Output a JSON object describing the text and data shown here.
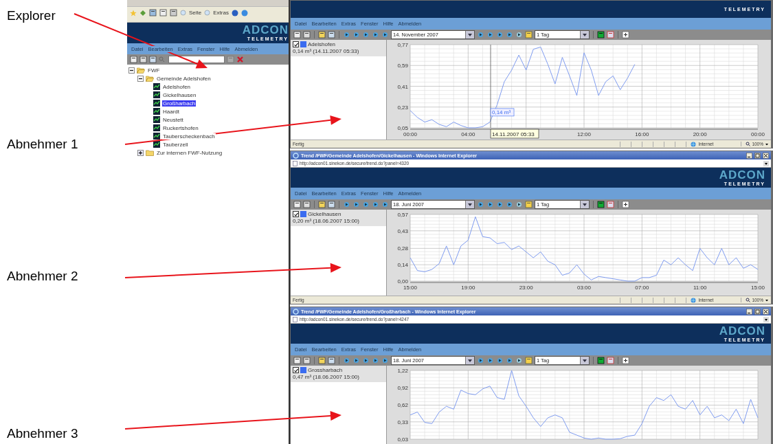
{
  "annotations": [
    {
      "text": "Explorer"
    },
    {
      "text": "Abnehmer 1"
    },
    {
      "text": "Abnehmer 2"
    },
    {
      "text": "Abnehmer 3"
    }
  ],
  "explorer": {
    "browser_toolbar": [
      "Seite",
      "Extras"
    ],
    "logo": {
      "brand": "ADCON",
      "tagline": "TELEMETRY"
    },
    "menu": [
      "Datei",
      "Bearbeiten",
      "Extras",
      "Fenster",
      "Hilfe",
      "Abmelden"
    ],
    "tree": [
      {
        "label": "FWF",
        "kind": "folder",
        "expanded": true,
        "selected": false,
        "children": [
          {
            "label": "Gemeinde Adelshofen",
            "kind": "folder",
            "expanded": true,
            "selected": false,
            "children": [
              {
                "label": "Adelshofen",
                "kind": "station",
                "selected": false
              },
              {
                "label": "Gickelhausen",
                "kind": "station",
                "selected": false
              },
              {
                "label": "Großharbach",
                "kind": "station",
                "selected": true
              },
              {
                "label": "Haardt",
                "kind": "station",
                "selected": false
              },
              {
                "label": "Neustett",
                "kind": "station",
                "selected": false
              },
              {
                "label": "Ruckertshofen",
                "kind": "station",
                "selected": false
              },
              {
                "label": "Tauberscheckenbach",
                "kind": "station",
                "selected": false
              },
              {
                "label": "Tauberzell",
                "kind": "station",
                "selected": false
              }
            ]
          },
          {
            "label": "Zur internen FWF-Nutzung",
            "kind": "folder",
            "expanded": false,
            "selected": false
          }
        ]
      }
    ]
  },
  "windows": [
    {
      "logo": {
        "tagline": "TELEMETRY"
      },
      "menu": [
        "Datei",
        "Bearbeiten",
        "Extras",
        "Fenster",
        "Hilfe",
        "Abmelden"
      ],
      "date": "14. November 2007",
      "range": "1 Tag",
      "legend": {
        "checked": true,
        "color": "#3a6cf0",
        "reading": "0,14 m³ (14.11.2007 05:33)"
      },
      "chart_data": {
        "type": "line",
        "grid": true,
        "xlim": [
          0,
          24
        ],
        "ylim": [
          0.05,
          0.77
        ],
        "yticks": [
          {
            "value": 0.05,
            "label": "0,05"
          },
          {
            "value": 0.23,
            "label": "0,23"
          },
          {
            "value": 0.41,
            "label": "0,41"
          },
          {
            "value": 0.59,
            "label": "0,59"
          },
          {
            "value": 0.77,
            "label": "0,77"
          }
        ],
        "xticks": [
          {
            "value": 0,
            "label": "00:00"
          },
          {
            "value": 4,
            "label": "04:00"
          },
          {
            "value": 12,
            "label": "12:00"
          },
          {
            "value": 16,
            "label": "16:00"
          },
          {
            "value": 20,
            "label": "20:00"
          },
          {
            "value": 24,
            "label": "00:00"
          }
        ],
        "x": [
          0,
          0.5,
          1,
          1.5,
          2,
          2.5,
          3,
          3.5,
          4,
          4.5,
          5,
          5.5,
          6,
          6.5,
          7,
          7.5,
          8,
          8.5,
          9,
          9.5,
          10,
          10.5,
          11,
          11.5,
          12,
          12.5,
          13,
          13.5,
          14,
          14.5,
          15,
          15.5
        ],
        "series": [
          {
            "name": "Adelshofen",
            "color": "#7f9cf0",
            "values": [
              0.2,
              0.14,
              0.1,
              0.12,
              0.08,
              0.06,
              0.1,
              0.07,
              0.05,
              0.05,
              0.06,
              0.1,
              0.25,
              0.45,
              0.55,
              0.68,
              0.55,
              0.73,
              0.75,
              0.6,
              0.43,
              0.66,
              0.5,
              0.33,
              0.7,
              0.55,
              0.33,
              0.45,
              0.5,
              0.38,
              0.48,
              0.6
            ]
          }
        ],
        "ref_lines": [
          {
            "axis": "x",
            "value": 5.55
          }
        ],
        "annotations": [
          {
            "text": "0,14 m³",
            "x": 5.55,
            "y": 0.14
          },
          "14.11.2007 05:33"
        ]
      },
      "status": {
        "text": "Fertig",
        "zone": "Internet",
        "zoom": "100%"
      }
    },
    {
      "title": "Trend /FWF/Gemeinde Adelshofen/Gickelhausen - Windows Internet Explorer",
      "address": "http://adcon01.sinekon.de/secure/trend.do?panel=4320",
      "logo": {
        "brand": "ADCON",
        "tagline": "TELEMETRY"
      },
      "menu": [
        "Datei",
        "Bearbeiten",
        "Extras",
        "Fenster",
        "Hilfe",
        "Abmelden"
      ],
      "date": "18. Juni 2007",
      "range": "1 Tag",
      "legend": {
        "checked": true,
        "color": "#3a6cf0",
        "reading": "0,20 m³ (18.06.2007 15:00)"
      },
      "chart_data": {
        "type": "line",
        "grid": true,
        "ylim": [
          0,
          0.57
        ],
        "yticks": [
          {
            "value": 0,
            "label": "0,00"
          },
          {
            "value": 0.14,
            "label": "0,14"
          },
          {
            "value": 0.28,
            "label": "0,28"
          },
          {
            "value": 0.43,
            "label": "0,43"
          },
          {
            "value": 0.57,
            "label": "0,57"
          }
        ],
        "categories": [
          "15:00",
          null,
          null,
          null,
          null,
          null,
          null,
          null,
          "19:00",
          null,
          null,
          null,
          null,
          null,
          null,
          null,
          "23:00",
          null,
          null,
          null,
          null,
          null,
          null,
          null,
          "03:00",
          null,
          null,
          null,
          null,
          null,
          null,
          null,
          "07:00",
          null,
          null,
          null,
          null,
          null,
          null,
          null,
          "11:00",
          null,
          null,
          null,
          null,
          null,
          null,
          null,
          "15:00"
        ],
        "series": [
          {
            "name": "Gickelhausen",
            "color": "#7f9cf0",
            "values": [
              0.2,
              0.09,
              0.08,
              0.1,
              0.15,
              0.3,
              0.14,
              0.3,
              0.35,
              0.55,
              0.38,
              0.37,
              0.32,
              0.33,
              0.27,
              0.3,
              0.25,
              0.2,
              0.25,
              0.17,
              0.14,
              0.05,
              0.07,
              0.14,
              0.06,
              0.01,
              0.04,
              0.03,
              0.02,
              0.01,
              0.0,
              0.0,
              0.03,
              0.03,
              0.05,
              0.18,
              0.14,
              0.2,
              0.14,
              0.09,
              0.28,
              0.2,
              0.14,
              0.28,
              0.14,
              0.2,
              0.11,
              0.14,
              0.1
            ]
          }
        ]
      },
      "status": {
        "text": "Fertig",
        "zone": "Internet",
        "zoom": "100%"
      }
    },
    {
      "title": "Trend /FWF/Gemeinde Adelshofen/Großharbach - Windows Internet Explorer",
      "address": "http://adcon01.sinekon.de/secure/trend.do?panel=4247",
      "logo": {
        "brand": "ADCON",
        "tagline": "TELEMETRY"
      },
      "menu": [
        "Datei",
        "Bearbeiten",
        "Extras",
        "Fenster",
        "Hilfe",
        "Abmelden"
      ],
      "date": "18. Juni 2007",
      "range": "1 Tag",
      "legend": {
        "checked": true,
        "color": "#3a6cf0",
        "reading": "0,47 m³ (18.06.2007 15:00)"
      },
      "chart_data": {
        "type": "line",
        "grid": true,
        "ylim": [
          0.03,
          1.22
        ],
        "yticks": [
          {
            "value": 0.03,
            "label": "0,03"
          },
          {
            "value": 0.33,
            "label": "0,33"
          },
          {
            "value": 0.62,
            "label": "0,62"
          },
          {
            "value": 0.92,
            "label": "0,92"
          },
          {
            "value": 1.22,
            "label": "1,22"
          }
        ],
        "categories": [
          null,
          null,
          null,
          null,
          null,
          null,
          null,
          null,
          null,
          null,
          null,
          null,
          null,
          null,
          null,
          null,
          null,
          null,
          null,
          null,
          null,
          null,
          null,
          null,
          null,
          null,
          null,
          null,
          null,
          null,
          null,
          null,
          null,
          null,
          null,
          null,
          null,
          null,
          null,
          null,
          null,
          null,
          null,
          null,
          null,
          null,
          null,
          null,
          null
        ],
        "series": [
          {
            "name": "Grossharbach",
            "color": "#7f9cf0",
            "values": [
              0.45,
              0.5,
              0.32,
              0.3,
              0.5,
              0.6,
              0.55,
              0.88,
              0.82,
              0.8,
              0.9,
              0.95,
              0.75,
              0.72,
              1.22,
              0.78,
              0.6,
              0.4,
              0.25,
              0.4,
              0.45,
              0.4,
              0.15,
              0.1,
              0.05,
              0.03,
              0.05,
              0.03,
              0.03,
              0.04,
              0.08,
              0.1,
              0.3,
              0.6,
              0.75,
              0.7,
              0.8,
              0.6,
              0.55,
              0.7,
              0.45,
              0.6,
              0.4,
              0.45,
              0.35,
              0.55,
              0.3,
              0.72,
              0.4
            ]
          }
        ]
      }
    }
  ]
}
